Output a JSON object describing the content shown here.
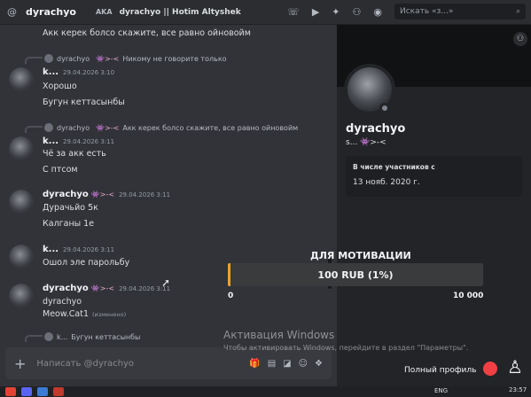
{
  "topbar": {
    "channel_name": "dyrachyo",
    "tag": "AKA",
    "nickname": "dyrachyo || Hotim Altyshek",
    "search_placeholder": "Искать «з...»",
    "icons": [
      "hash-icon",
      "phone-icon",
      "video-icon",
      "pin-icon",
      "add-friend-icon",
      "profile-icon",
      "search-icon"
    ]
  },
  "messages": [
    {
      "text": "Акк керек болсо скажите, все равно ойновойм"
    },
    {
      "reply": {
        "user": "dyrachyo",
        "badge": "👾>-<",
        "text": "Никому не говорите только"
      },
      "author": "k...",
      "time": "29.04.2026 3:10",
      "lines": [
        "Хорошо",
        "Бугун кеттасынбы"
      ]
    },
    {
      "reply": {
        "user": "dyrachyo",
        "badge": "👾>-<",
        "text": "Акк керек болсо скажите, все равно ойновойм"
      },
      "author": "k...",
      "time": "29.04.2026 3:11",
      "lines": [
        "Чё за акк есть",
        "С птсом"
      ]
    },
    {
      "author": "dyrachyo",
      "badge": "👾>-<",
      "time": "29.04.2026 3:11",
      "lines": [
        "Дурачьйо 5к",
        "Калганы 1е"
      ]
    },
    {
      "author": "k...",
      "time": "29.04.2026 3:11",
      "lines": [
        "Ошол эле парольбу"
      ]
    },
    {
      "author": "dyrachyo",
      "badge": "👾>-<",
      "time": "29.04.2026 3:11",
      "lines": [
        "dyrachyo",
        "Meow.Cat1"
      ],
      "edited": "(изменено)"
    },
    {
      "reply": {
        "user": "k...",
        "badge": "",
        "text": "Бугун кеттасынбы"
      }
    }
  ],
  "input": {
    "placeholder": "Написать @dyrachyo"
  },
  "profile": {
    "display_name": "dyrachyo",
    "username": "s... 👾>-<",
    "member_since_title": "В числе участников с",
    "member_since_date": "13 нояб. 2020 г.",
    "full_profile_label": "Полный профиль"
  },
  "donation": {
    "title": "ДЛЯ МОТИВАЦИИ",
    "label": "100 RUB (1%)",
    "progress": 0.01,
    "min_label": "0",
    "max_label": "10 000",
    "fill_color": "#f0a030"
  },
  "watermark": {
    "title": "Активация Windows",
    "subtitle": "Чтобы активировать Windows, перейдите в раздел \"Параметры\"."
  },
  "taskbar": {
    "lang": "ENG",
    "time": "23:57"
  }
}
